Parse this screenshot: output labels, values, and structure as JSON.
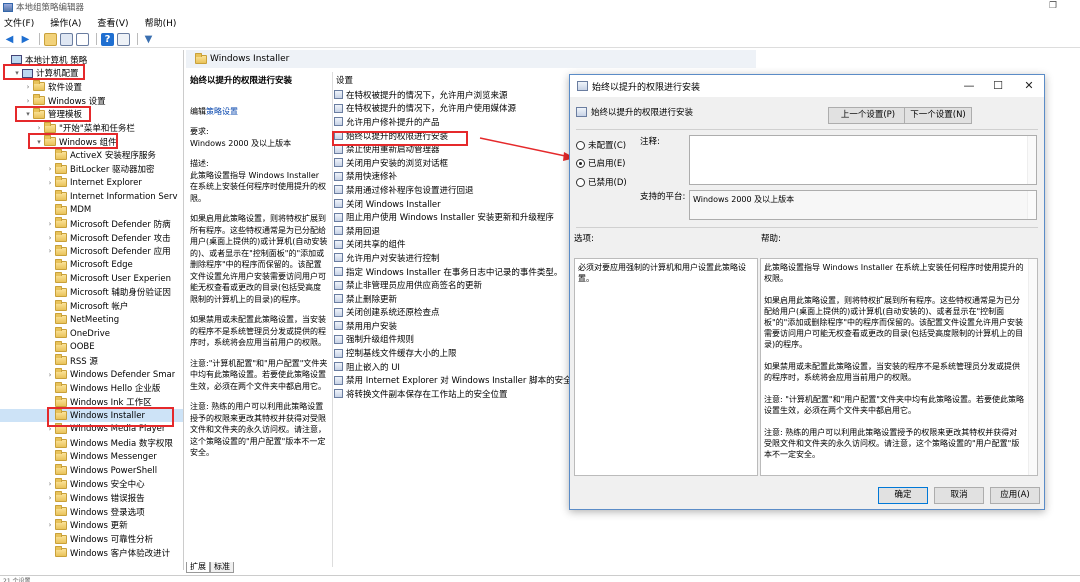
{
  "window": {
    "title": "本地组策略编辑器"
  },
  "menu": [
    "文件(F)",
    "操作(A)",
    "查看(V)",
    "帮助(H)"
  ],
  "tree": {
    "items": [
      {
        "label": "本地计算机 策略",
        "indent": 0,
        "arrow": "",
        "icon": "pc"
      },
      {
        "label": "计算机配置",
        "indent": 1,
        "arrow": "▾",
        "icon": "pc"
      },
      {
        "label": "软件设置",
        "indent": 2,
        "arrow": "›",
        "icon": "folder"
      },
      {
        "label": "Windows 设置",
        "indent": 2,
        "arrow": "›",
        "icon": "folder"
      },
      {
        "label": "管理模板",
        "indent": 2,
        "arrow": "▾",
        "icon": "folder"
      },
      {
        "label": "\"开始\"菜单和任务栏",
        "indent": 3,
        "arrow": "›",
        "icon": "folder"
      },
      {
        "label": "Windows 组件",
        "indent": 3,
        "arrow": "▾",
        "icon": "folder"
      },
      {
        "label": "ActiveX 安装程序服务",
        "indent": 4,
        "arrow": "",
        "icon": "folder"
      },
      {
        "label": "BitLocker 驱动器加密",
        "indent": 4,
        "arrow": "›",
        "icon": "folder"
      },
      {
        "label": "Internet Explorer",
        "indent": 4,
        "arrow": "›",
        "icon": "folder"
      },
      {
        "label": "Internet Information Serv",
        "indent": 4,
        "arrow": "",
        "icon": "folder"
      },
      {
        "label": "MDM",
        "indent": 4,
        "arrow": "",
        "icon": "folder"
      },
      {
        "label": "Microsoft Defender 防病",
        "indent": 4,
        "arrow": "›",
        "icon": "folder"
      },
      {
        "label": "Microsoft Defender 攻击",
        "indent": 4,
        "arrow": "›",
        "icon": "folder"
      },
      {
        "label": "Microsoft Defender 应用",
        "indent": 4,
        "arrow": "›",
        "icon": "folder"
      },
      {
        "label": "Microsoft Edge",
        "indent": 4,
        "arrow": "",
        "icon": "folder"
      },
      {
        "label": "Microsoft User Experien",
        "indent": 4,
        "arrow": "",
        "icon": "folder"
      },
      {
        "label": "Microsoft 辅助身份验证因",
        "indent": 4,
        "arrow": "",
        "icon": "folder"
      },
      {
        "label": "Microsoft 帐户",
        "indent": 4,
        "arrow": "",
        "icon": "folder"
      },
      {
        "label": "NetMeeting",
        "indent": 4,
        "arrow": "",
        "icon": "folder"
      },
      {
        "label": "OneDrive",
        "indent": 4,
        "arrow": "",
        "icon": "folder"
      },
      {
        "label": "OOBE",
        "indent": 4,
        "arrow": "",
        "icon": "folder"
      },
      {
        "label": "RSS 源",
        "indent": 4,
        "arrow": "",
        "icon": "folder"
      },
      {
        "label": "Windows Defender Smar",
        "indent": 4,
        "arrow": "›",
        "icon": "folder"
      },
      {
        "label": "Windows Hello 企业版",
        "indent": 4,
        "arrow": "",
        "icon": "folder"
      },
      {
        "label": "Windows Ink 工作区",
        "indent": 4,
        "arrow": "",
        "icon": "folder"
      },
      {
        "label": "Windows Installer",
        "indent": 4,
        "arrow": "",
        "icon": "folder",
        "selected": true
      },
      {
        "label": "Windows Media Player",
        "indent": 4,
        "arrow": "›",
        "icon": "folder"
      },
      {
        "label": "Windows Media 数字权限",
        "indent": 4,
        "arrow": "",
        "icon": "folder"
      },
      {
        "label": "Windows Messenger",
        "indent": 4,
        "arrow": "",
        "icon": "folder"
      },
      {
        "label": "Windows PowerShell",
        "indent": 4,
        "arrow": "",
        "icon": "folder"
      },
      {
        "label": "Windows 安全中心",
        "indent": 4,
        "arrow": "›",
        "icon": "folder"
      },
      {
        "label": "Windows 错误报告",
        "indent": 4,
        "arrow": "›",
        "icon": "folder"
      },
      {
        "label": "Windows 登录选项",
        "indent": 4,
        "arrow": "",
        "icon": "folder"
      },
      {
        "label": "Windows 更新",
        "indent": 4,
        "arrow": "›",
        "icon": "folder"
      },
      {
        "label": "Windows 可靠性分析",
        "indent": 4,
        "arrow": "",
        "icon": "folder"
      },
      {
        "label": "Windows 客户体验改进计",
        "indent": 4,
        "arrow": "",
        "icon": "folder"
      }
    ]
  },
  "middle": {
    "folder_title": "Windows Installer",
    "policy_title": "始终以提升的权限进行安装",
    "edit_prefix": "编辑",
    "edit_link": "策略设置",
    "requirements_label": "要求:",
    "requirements_value": "Windows 2000 及以上版本",
    "description_label": "描述:",
    "description_paras": [
      "此策略设置指导 Windows Installer 在系统上安装任何程序时使用提升的权限。",
      "如果启用此策略设置，则将特权扩展到所有程序。这些特权通常是为已分配给用户(桌面上提供的)或计算机(自动安装的)、或者显示在\"控制面板\"的\"添加或删除程序\"中的程序而保留的。该配置文件设置允许用户安装需要访问用户可能无权查看或更改的目录(包括受高度限制的计算机上的目录)的程序。",
      "如果禁用或未配置此策略设置，当安装的程序不是系统管理员分发或提供的程序时，系统将会应用当前用户的权限。",
      "注意:\"计算机配置\"和\"用户配置\"文件夹中均有此策略设置。若要使此策略设置生效，必须在两个文件夹中都启用它。",
      "注意: 熟练的用户可以利用此策略设置授予的权限来更改其特权并获得对受限文件和文件夹的永久访问权。请注意，这个策略设置的\"用户配置\"版本不一定安全。"
    ],
    "settings_header": "设置",
    "settings": [
      "在特权被提升的情况下，允许用户浏览来源",
      "在特权被提升的情况下，允许用户使用媒体源",
      "允许用户修补提升的产品",
      "始终以提升的权限进行安装",
      "禁止使用重新启动管理器",
      "关闭用户安装的浏览对话框",
      "禁用快速修补",
      "禁用通过修补程序包设置进行回退",
      "关闭 Windows Installer",
      "阻止用户使用 Windows Installer 安装更新和升级程序",
      "禁用回退",
      "关闭共享的组件",
      "允许用户对安装进行控制",
      "指定 Windows Installer 在事务日志中记录的事件类型。",
      "禁止非管理员应用供应商签名的更新",
      "禁止删除更新",
      "关闭创建系统还原检查点",
      "禁用用户安装",
      "强制升级组件规则",
      "控制基线文件缓存大小的上限",
      "阻止嵌入的 UI",
      "禁用 Internet Explorer 对 Windows Installer 脚本的安全...",
      "将转换文件副本保存在工作站上的安全位置"
    ],
    "tabs": [
      "扩展",
      "标准"
    ]
  },
  "dialog": {
    "title": "始终以提升的权限进行安装",
    "heading": "始终以提升的权限进行安装",
    "prev_button": "上一个设置(P)",
    "next_button": "下一个设置(N)",
    "radios": [
      {
        "label": "未配置(C)",
        "checked": false
      },
      {
        "label": "已启用(E)",
        "checked": true
      },
      {
        "label": "已禁用(D)",
        "checked": false
      }
    ],
    "comment_label": "注释:",
    "supported_label": "支持的平台:",
    "supported_value": "Windows 2000 及以上版本",
    "options_label": "选项:",
    "help_label": "帮助:",
    "options_text": "必须对要应用强制的计算机和用户设置此策略设置。",
    "help_paras": [
      "此策略设置指导 Windows Installer 在系统上安装任何程序时使用提升的权限。",
      "如果启用此策略设置，则将特权扩展到所有程序。这些特权通常是为已分配给用户(桌面上提供的)或计算机(自动安装的)、或者显示在\"控制面板\"的\"添加或删除程序\"中的程序而保留的。该配置文件设置允许用户安装需要访问用户可能无权查看或更改的目录(包括受高度限制的计算机上的目录)的程序。",
      "如果禁用或未配置此策略设置，当安装的程序不是系统管理员分发或提供的程序时，系统将会应用当前用户的权限。",
      "注意: \"计算机配置\"和\"用户配置\"文件夹中均有此策略设置。若要使此策略设置生效，必须在两个文件夹中都启用它。",
      "注意: 熟练的用户可以利用此策略设置授予的权限来更改其特权并获得对受限文件和文件夹的永久访问权。请注意，这个策略设置的\"用户配置\"版本不一定安全。"
    ],
    "ok": "确定",
    "cancel": "取消",
    "apply": "应用(A)"
  },
  "status": {
    "text": "21 个设置"
  },
  "colors": {
    "accent": "#0078d7",
    "highlight": "#e5292b",
    "selection": "#cde3f7"
  }
}
